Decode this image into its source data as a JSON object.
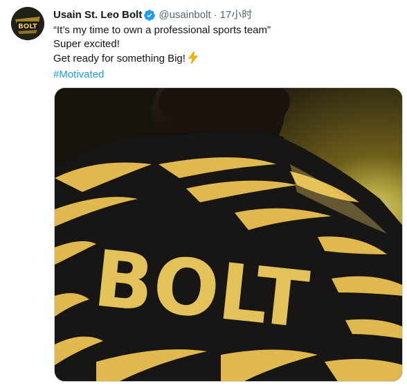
{
  "tweet": {
    "display_name": "Usain St. Leo Bolt",
    "handle": "@usainbolt",
    "separator": "·",
    "timestamp": "17小时",
    "lines": [
      "“It’s my time to own a professional sports team”",
      "Super excited!",
      "Get ready for something Big!"
    ],
    "hashtag": "#Motivated"
  },
  "avatar": {
    "logo_text": "BOLT"
  },
  "media": {
    "jersey_text": "BOLT"
  },
  "colors": {
    "text": "#0f1419",
    "secondary": "#536471",
    "link": "#1d9bf0",
    "verified": "#1d9bf0",
    "jersey_gold": "#e0b94e",
    "jersey_dark": "#171614"
  },
  "icons": {
    "verified": "verified-badge-icon",
    "emoji": "high-voltage-emoji"
  }
}
